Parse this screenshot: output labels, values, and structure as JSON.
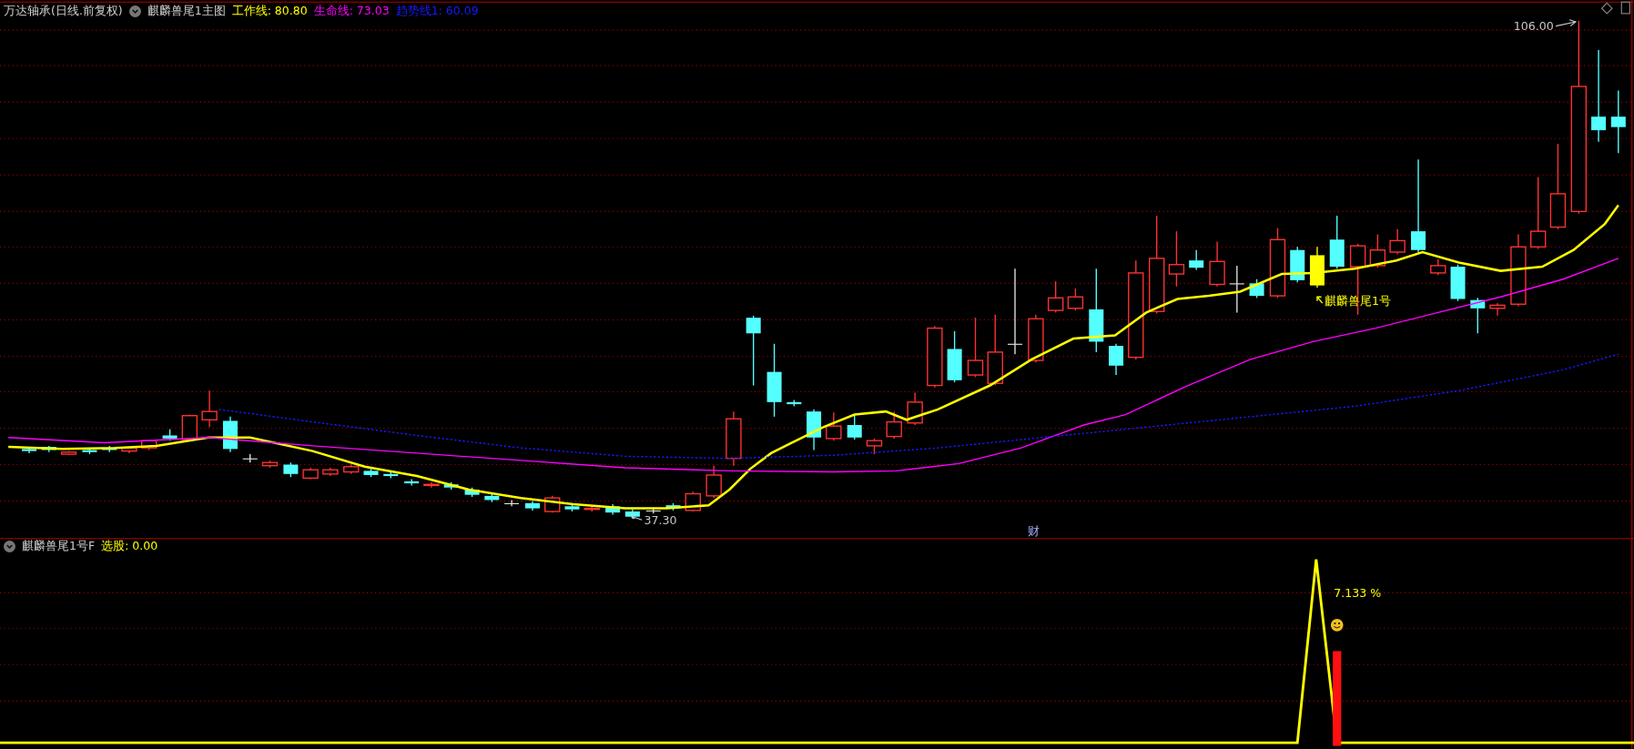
{
  "main_chart": {
    "title": "万达轴承(日线.前复权)",
    "indicator_name": "麒麟兽尾1主图",
    "indicators": [
      {
        "label": "工作线: 80.80",
        "color": "#ffff00"
      },
      {
        "label": "生命线: 73.03",
        "color": "#ff00ff"
      },
      {
        "label": "趋势线1: 60.09",
        "color": "#1a1aff"
      }
    ],
    "high_label": "106.00",
    "low_label": "37.30",
    "marker": "财",
    "signal_label": "麒麟兽尾1号"
  },
  "sub_chart": {
    "indicator_name": "麒麟兽尾1号F",
    "value": "选股: 0.00",
    "percent_label": "7.133 %"
  }
}
